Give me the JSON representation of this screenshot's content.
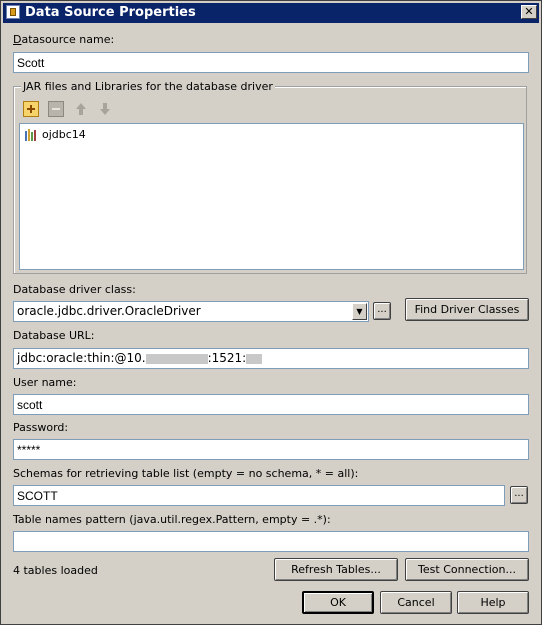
{
  "window": {
    "title": "Data Source Properties",
    "close_glyph": "✕"
  },
  "datasource": {
    "label": "Datasource name:",
    "value": "Scott"
  },
  "jar_group": {
    "title": "JAR files and Libraries for the database driver",
    "items": [
      {
        "name": "ojdbc14",
        "icon": "library-icon"
      }
    ],
    "toolbar": [
      "add-icon",
      "remove-icon",
      "move-up-icon",
      "move-down-icon"
    ]
  },
  "driver": {
    "label": "Database driver class:",
    "value": "oracle.jdbc.driver.OracleDriver",
    "browse_label": "...",
    "find_label": "Find Driver Classes"
  },
  "url": {
    "label": "Database URL:",
    "value_prefix": "jdbc:oracle:thin:@10.",
    "value_mid": ":1521:"
  },
  "user": {
    "label": "User name:",
    "value": "scott"
  },
  "password": {
    "label": "Password:",
    "value": "*****"
  },
  "schemas": {
    "label": "Schemas for retrieving table list (empty = no schema, * = all):",
    "value": "SCOTT",
    "browse_label": "..."
  },
  "pattern": {
    "label": "Table names pattern (java.util.regex.Pattern, empty = .*):",
    "value": ""
  },
  "status": {
    "text": "4 tables loaded"
  },
  "buttons": {
    "refresh": "Refresh Tables...",
    "test": "Test Connection...",
    "ok": "OK",
    "cancel": "Cancel",
    "help": "Help"
  }
}
